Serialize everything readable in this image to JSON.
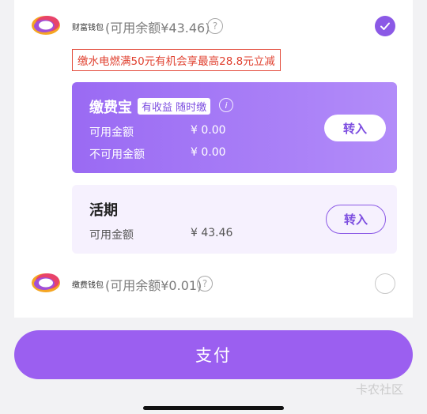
{
  "wallet1": {
    "name": "财富钱包",
    "available": "(可用余额¥43.46)",
    "help": "?",
    "selected": true
  },
  "promo": "缴水电燃满50元有机会享最高28.8元立减",
  "card1": {
    "title": "缴费宝",
    "badge": "有收益 随时缴",
    "info": "i",
    "rows": [
      {
        "label": "可用金额",
        "value": "¥ 0.00"
      },
      {
        "label": "不可用金额",
        "value": "¥ 0.00"
      }
    ],
    "button": "转入"
  },
  "card2": {
    "title": "活期",
    "rows": [
      {
        "label": "可用金额",
        "value": "¥ 43.46"
      }
    ],
    "button": "转入"
  },
  "wallet2": {
    "name": "缴费钱包",
    "available": "(可用余额¥0.01)",
    "help": "?",
    "selected": false
  },
  "pay_button": "支付",
  "watermark": "卡农社区",
  "colors": {
    "accent": "#8b59e6",
    "pay_button": "#9b5ff0",
    "promo_red": "#e0402f",
    "card_light": "#f6f1fe"
  }
}
